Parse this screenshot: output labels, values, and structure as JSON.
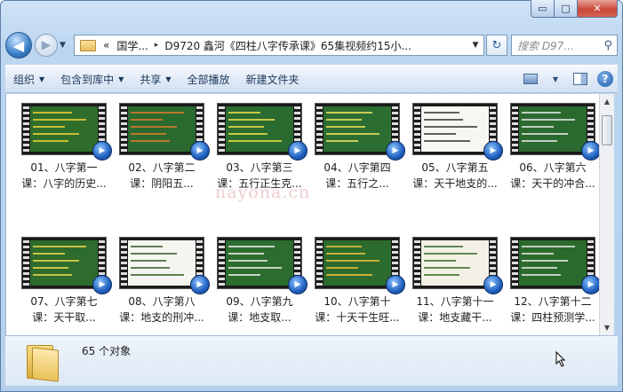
{
  "window": {
    "caption": {
      "minimize": "▭",
      "maximize": "□",
      "close": "✕"
    }
  },
  "nav": {
    "back": "◀",
    "forward": "▶",
    "address": {
      "prefix": "«",
      "segments": [
        "国学...",
        "D9720 鑫河《四柱八字传承课》65集视频约15小..."
      ],
      "separator": "▸"
    },
    "search_placeholder": "搜索 D97..."
  },
  "toolbar": {
    "organize": "组织",
    "include_in_library": "包含到库中",
    "share": "共享",
    "play_all": "全部播放",
    "new_folder": "新建文件夹"
  },
  "files": [
    {
      "line1": "01、八字第一",
      "line2": "课：八字的历史...",
      "bg": "#2f6e2a",
      "accent": "#f2d23a"
    },
    {
      "line1": "02、八字第二",
      "line2": "课：阴阳五...",
      "bg": "#2b6a2f",
      "accent": "#e07a2a"
    },
    {
      "line1": "03、八字第三",
      "line2": "课：五行正生克...",
      "bg": "#2a6b30",
      "accent": "#f0e04a"
    },
    {
      "line1": "04、八字第四",
      "line2": "课：五行之...",
      "bg": "#2c6d31",
      "accent": "#f1e35c"
    },
    {
      "line1": "05、八字第五",
      "line2": "课：天干地支的...",
      "bg": "#f7f7f2",
      "accent": "#3a3a3a"
    },
    {
      "line1": "06、八字第六",
      "line2": "课：天干的冲合...",
      "bg": "#2a6a2e",
      "accent": "#e9e9e9"
    },
    {
      "line1": "07、八字第七",
      "line2": "课：天干取...",
      "bg": "#2d6c2d",
      "accent": "#f0d84a"
    },
    {
      "line1": "08、八字第八",
      "line2": "课：地支的刑冲...",
      "bg": "#f5f5ef",
      "accent": "#3a5f2a"
    },
    {
      "line1": "09、八字第九",
      "line2": "课：地支取...",
      "bg": "#2c6c2f",
      "accent": "#eeeeee"
    },
    {
      "line1": "10、八字第十",
      "line2": "课：十天干生旺...",
      "bg": "#2b6b2d",
      "accent": "#f0c23a"
    },
    {
      "line1": "11、八字第十一",
      "line2": "课：地支藏干...",
      "bg": "#f3f1e6",
      "accent": "#3f6e2f"
    },
    {
      "line1": "12、八字第十二",
      "line2": "课：四柱预测学...",
      "bg": "#2a6a2c",
      "accent": "#e8e8e8"
    }
  ],
  "status": {
    "count": "65 个对象"
  },
  "watermark": "nayona.cn",
  "colors": {
    "frame": "#b6d0ec",
    "chalkboard": "#2c6c2f",
    "media_badge": "#1f5fbf"
  }
}
